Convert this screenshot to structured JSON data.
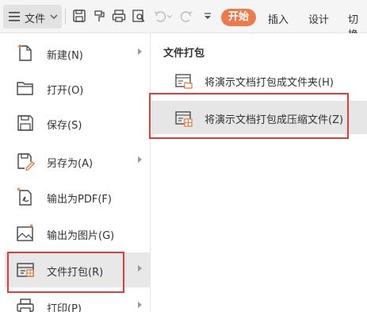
{
  "toolbar": {
    "file_label": "文件",
    "start_label": "开始",
    "tabs": [
      "插入",
      "设计",
      "切换"
    ]
  },
  "file_menu": {
    "items": [
      {
        "label": "新建(N)",
        "icon": "new-file-icon",
        "has_submenu": true
      },
      {
        "label": "打开(O)",
        "icon": "open-folder-icon",
        "has_submenu": false
      },
      {
        "label": "保存(S)",
        "icon": "save-icon",
        "has_submenu": false
      },
      {
        "label": "另存为(A)",
        "icon": "save-as-icon",
        "has_submenu": true
      },
      {
        "label": "输出为PDF(F)",
        "icon": "export-pdf-icon",
        "has_submenu": false
      },
      {
        "label": "输出为图片(G)",
        "icon": "export-image-icon",
        "has_submenu": false
      },
      {
        "label": "文件打包(R)",
        "icon": "package-icon",
        "has_submenu": true,
        "active": true
      },
      {
        "label": "打印(P)",
        "icon": "print-icon",
        "has_submenu": true
      }
    ]
  },
  "submenu": {
    "title": "文件打包",
    "items": [
      {
        "label": "将演示文档打包成文件夹(H)",
        "icon": "package-folder-icon"
      },
      {
        "label": "将演示文档打包成压缩文件(Z)",
        "icon": "package-zip-icon",
        "active": true
      }
    ]
  },
  "colors": {
    "accent": "#ec7a4a",
    "highlight_border": "#e23b3b",
    "icon_orange": "#e8743b"
  }
}
